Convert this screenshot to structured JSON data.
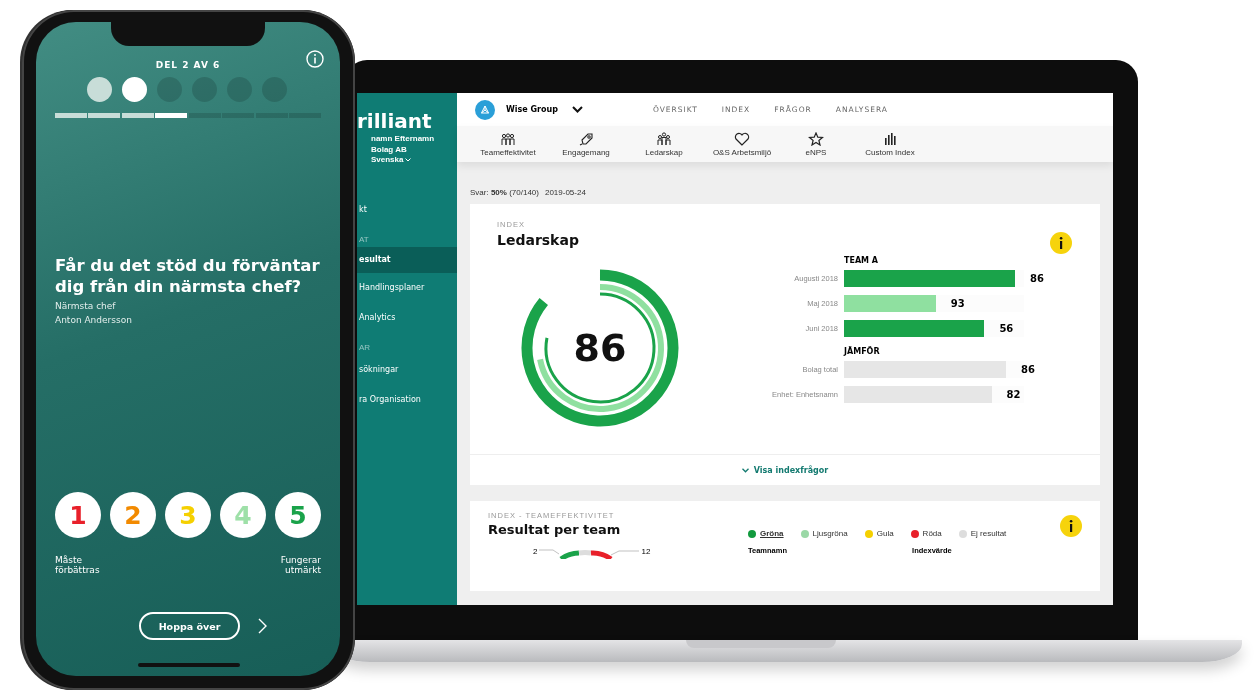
{
  "phone": {
    "part_label": "DEL 2 AV 6",
    "steps": [
      {
        "done": true,
        "selected": false
      },
      {
        "done": true,
        "selected": true
      },
      {
        "done": false,
        "selected": false
      },
      {
        "done": false,
        "selected": false
      },
      {
        "done": false,
        "selected": false
      },
      {
        "done": false,
        "selected": false
      }
    ],
    "progress_segments": [
      {
        "done": true,
        "selected": false
      },
      {
        "done": true,
        "selected": false
      },
      {
        "done": true,
        "selected": false
      },
      {
        "done": true,
        "selected": true
      },
      {
        "done": false,
        "selected": false
      },
      {
        "done": false,
        "selected": false
      },
      {
        "done": false,
        "selected": false
      },
      {
        "done": false,
        "selected": false
      }
    ],
    "question": "Får du det stöd du förväntar dig från din närmsta chef?",
    "subject_role": "Närmsta chef",
    "subject_name": "Anton Andersson",
    "scale": [
      {
        "label": "1",
        "color": "#e8202a"
      },
      {
        "label": "2",
        "color": "#f28a00"
      },
      {
        "label": "3",
        "color": "#f5d000"
      },
      {
        "label": "4",
        "color": "#9ee0a8"
      },
      {
        "label": "5",
        "color": "#1aa34a"
      }
    ],
    "scale_low": "Måste förbättras",
    "scale_high": "Fungerar utmärkt",
    "skip_button": "Hoppa över"
  },
  "laptop": {
    "sidebar": {
      "logo": "rilliant",
      "user": "namn Efternamn",
      "company": "Bolag AB",
      "language": "Svenska",
      "entries": [
        {
          "kind": "item",
          "label": "kt",
          "selected": false
        },
        {
          "kind": "section",
          "label": "AT"
        },
        {
          "kind": "item",
          "label": "esultat",
          "selected": true
        },
        {
          "kind": "item",
          "label": "Handlingsplaner",
          "selected": false
        },
        {
          "kind": "item",
          "label": "Analytics",
          "selected": false
        },
        {
          "kind": "section",
          "label": "AR"
        },
        {
          "kind": "item",
          "label": "sökningar",
          "selected": false
        },
        {
          "kind": "item",
          "label": "ra Organisation",
          "selected": false
        }
      ]
    },
    "org": "Wise Group",
    "nav": [
      "ÖVERSIKT",
      "INDEX",
      "FRÅGOR",
      "ANALYSERA"
    ],
    "index_tabs": [
      {
        "kind": "team",
        "label": "Teameffektivitet"
      },
      {
        "kind": "engagement",
        "label": "Engagemang"
      },
      {
        "kind": "leadership",
        "label": "Ledarskap"
      },
      {
        "kind": "health",
        "label": "O&S Arbetsmiljö"
      },
      {
        "kind": "enps",
        "label": "eNPS"
      },
      {
        "kind": "custom",
        "label": "Custom Index"
      }
    ],
    "response_summary": "Svar: **50%** (70/140)",
    "date": "2019-05-24",
    "index_card": {
      "eyebrow": "INDEX",
      "title": "Ledarskap",
      "score": "86",
      "groups": [
        {
          "heading": "TEAM A",
          "rows": [
            {
              "label": "Augusti 2018",
              "value": "86",
              "level": 0.95,
              "color": "#1aa34a"
            },
            {
              "label": "Maj 2018",
              "value": "93",
              "level": 0.51,
              "color": "#8fe0a0"
            },
            {
              "label": "Juni 2018",
              "value": "56",
              "level": 0.78,
              "color": "#1aa34a"
            }
          ]
        },
        {
          "heading": "JÄMFÖR",
          "rows": [
            {
              "label": "Bolag total",
              "value": "86",
              "level": 0.9,
              "color": "#e6e6e6"
            },
            {
              "label": "Enhet: Enhetsnamn",
              "value": "82",
              "level": 0.82,
              "color": "#e6e6e6"
            }
          ]
        }
      ],
      "footer_link": "Visa indexfrågor"
    },
    "team_card": {
      "eyebrow": "INDEX - TEAMEFFEKTIVITET",
      "title": "Resultat per team",
      "legend": [
        {
          "label": "Gröna",
          "color": "#129a3e",
          "selected": true
        },
        {
          "label": "Ljusgröna",
          "color": "#9ad8a6",
          "selected": false
        },
        {
          "label": "Gula",
          "color": "#f5d000",
          "selected": false
        },
        {
          "label": "Röda",
          "color": "#e8202a",
          "selected": false
        },
        {
          "label": "Ej resultat",
          "color": "#dddddd",
          "selected": false
        }
      ],
      "pie_labels": [
        "2",
        "12"
      ],
      "columns": [
        "Teamnamn",
        "Indexvärde"
      ]
    }
  }
}
